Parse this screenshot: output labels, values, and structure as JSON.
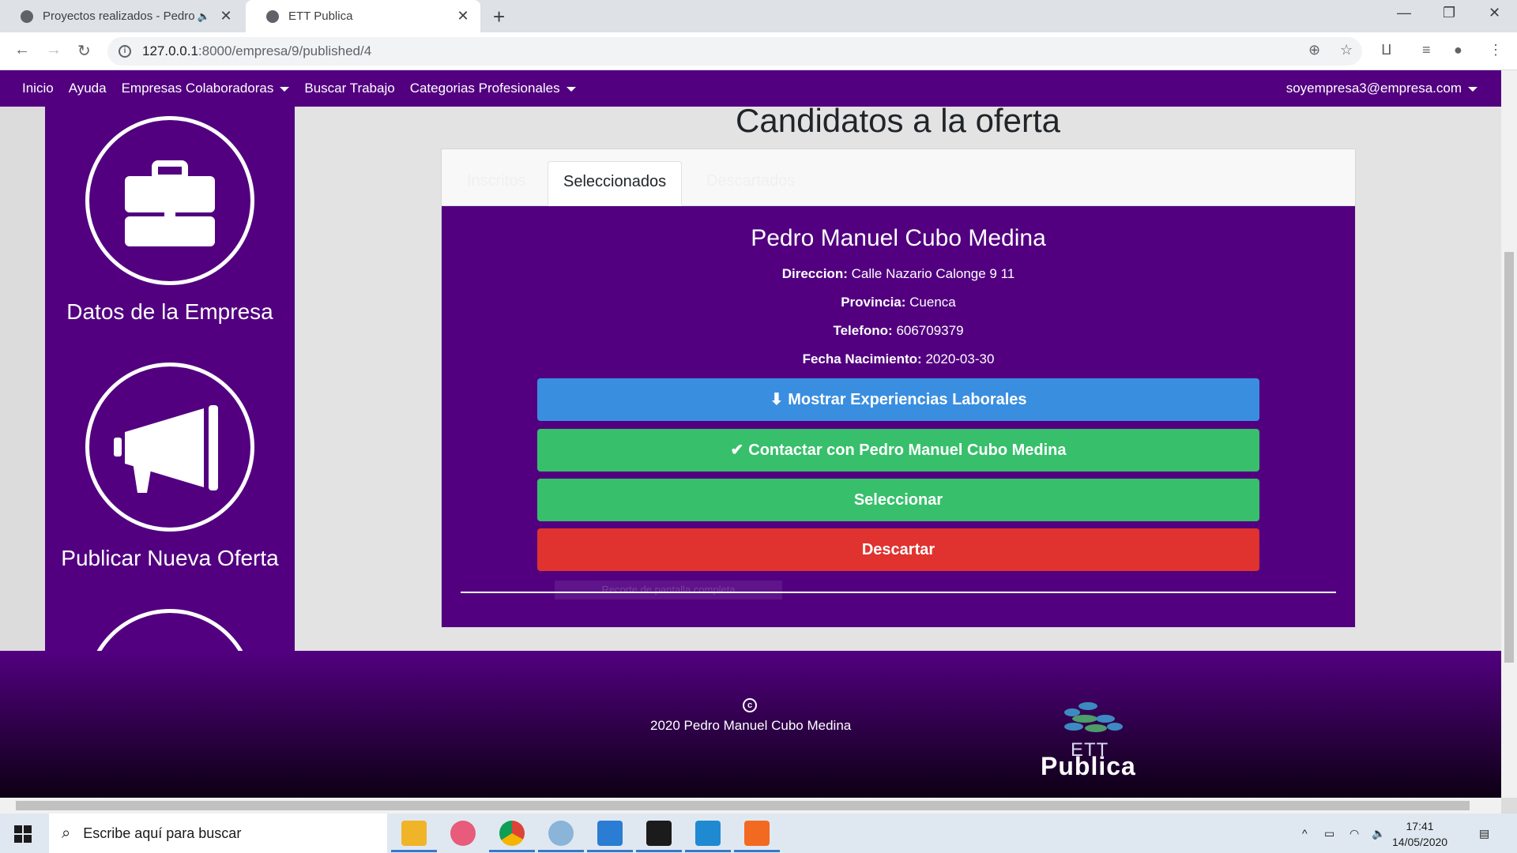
{
  "browser": {
    "tabs": [
      {
        "title": "Proyectos realizados - Pedro",
        "active": false,
        "audio": true
      },
      {
        "title": "ETT Publica",
        "active": true
      }
    ],
    "url_host": "127.0.0.1",
    "url_path": ":8000/empresa/9/published/4"
  },
  "nav": {
    "items": [
      "Inicio",
      "Ayuda",
      "Empresas Colaboradoras",
      "Buscar Trabajo",
      "Categorias Profesionales"
    ],
    "user": "soyempresa3@empresa.com"
  },
  "sidebar": {
    "items": [
      {
        "label": "Datos de la Empresa",
        "icon": "briefcase-icon"
      },
      {
        "label": "Publicar Nueva Oferta",
        "icon": "megaphone-icon"
      }
    ]
  },
  "main": {
    "heading": "Candidatos a la oferta",
    "tabs": [
      "Inscritos",
      "Seleccionados",
      "Descartados"
    ],
    "active_tab": "Seleccionados",
    "candidate": {
      "name": "Pedro Manuel Cubo Medina",
      "fields": [
        {
          "label": "Direccion:",
          "value": "Calle Nazario Calonge 9 11"
        },
        {
          "label": "Provincia:",
          "value": "Cuenca"
        },
        {
          "label": "Telefono:",
          "value": "606709379"
        },
        {
          "label": "Fecha Nacimiento:",
          "value": "2020-03-30"
        }
      ]
    },
    "buttons": {
      "experiences": "Mostrar Experiencias Laborales",
      "contact": "Contactar con Pedro Manuel Cubo Medina",
      "select": "Seleccionar",
      "discard": "Descartar"
    },
    "ghost_text": "Recorte de pantalla completa"
  },
  "footer": {
    "copyright_symbol": "c",
    "text": "2020 Pedro Manuel Cubo Medina",
    "logo_line1": "ETT",
    "logo_line2": "Publica"
  },
  "taskbar": {
    "search_placeholder": "Escribe aquí para buscar",
    "time": "17:41",
    "date": "14/05/2020"
  },
  "colors": {
    "brand_purple": "#520080",
    "blue": "#3a8ee0",
    "green": "#37bf6b",
    "red": "#e0322f"
  }
}
